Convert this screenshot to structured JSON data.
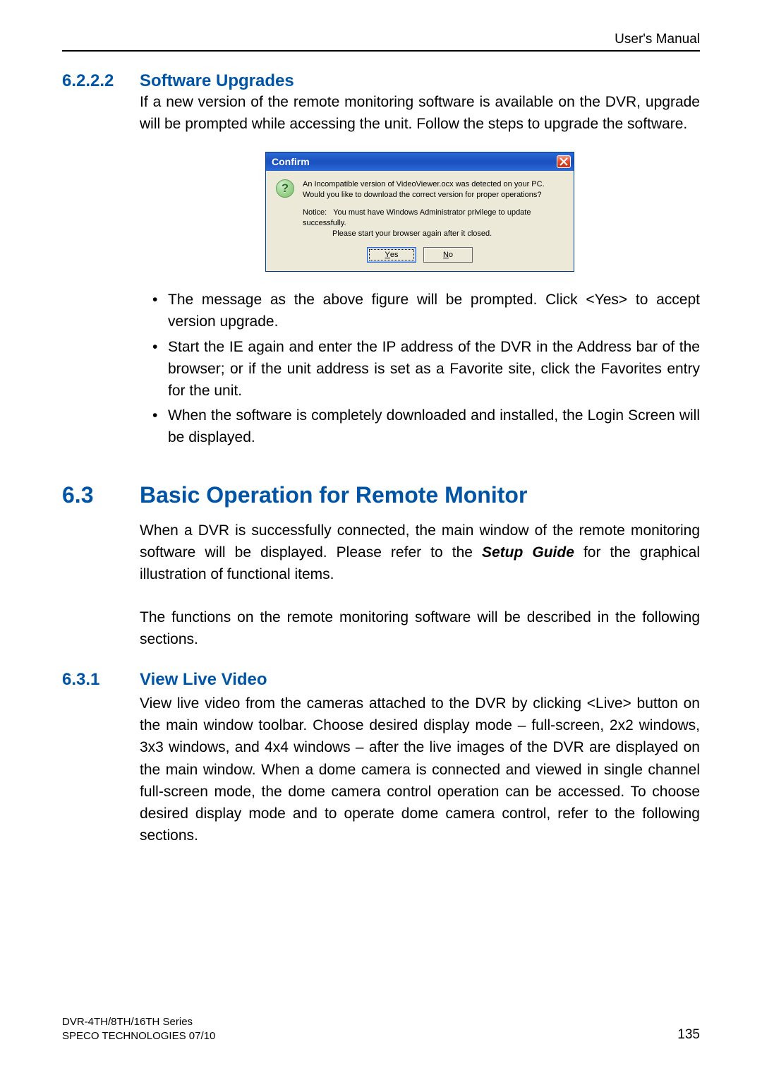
{
  "header": {
    "doc_label": "User's Manual"
  },
  "sec_6222": {
    "num": "6.2.2.2",
    "title": "Software Upgrades",
    "intro": "If a new version of the remote monitoring software is available on the DVR, upgrade will be prompted while accessing the unit. Follow the steps to upgrade the software.",
    "bullets": [
      "The message as the above figure will be prompted. Click <Yes> to accept version upgrade.",
      "Start the IE again and enter the IP address of the DVR in the Address bar of the browser; or if the unit address is set as a Favorite site, click the Favorites entry for the unit.",
      "When the software is completely downloaded and installed, the Login Screen will be displayed."
    ]
  },
  "dialog": {
    "title": "Confirm",
    "q_line1": "An Incompatible version of VideoViewer.ocx was detected on your PC.",
    "q_line2": "Would you like to download the correct version for proper operations?",
    "notice_label": "Notice:",
    "notice_1": "You must have Windows Administrator privilege to update successfully.",
    "notice_2": "Please start your browser again after it closed.",
    "yes_accel": "Y",
    "yes_rest": "es",
    "no_accel": "N",
    "no_rest": "o"
  },
  "sec_63": {
    "num": "6.3",
    "title": "Basic Operation for Remote Monitor",
    "p1_a": "When a DVR is successfully connected, the main window of the remote monitoring software will be displayed. Please refer to the ",
    "setup_guide": "Setup Guide",
    "p1_b": " for the graphical illustration of functional items.",
    "p2": "The functions on the remote monitoring software will be described in the following sections."
  },
  "sec_631": {
    "num": "6.3.1",
    "title": "View Live Video",
    "p": "View live video from the cameras attached to the DVR by clicking <Live> button on the main window toolbar. Choose desired display mode – full-screen, 2x2 windows, 3x3 windows, and 4x4 windows – after the live images of the DVR are displayed on the main window. When a dome camera is connected and viewed in single channel full-screen mode, the dome camera control operation can be accessed. To choose desired display mode and to operate dome camera control, refer to the following sections."
  },
  "footer": {
    "series": "DVR-4TH/8TH/16TH Series",
    "company": "SPECO TECHNOLOGIES 07/10",
    "page_no": "135"
  }
}
